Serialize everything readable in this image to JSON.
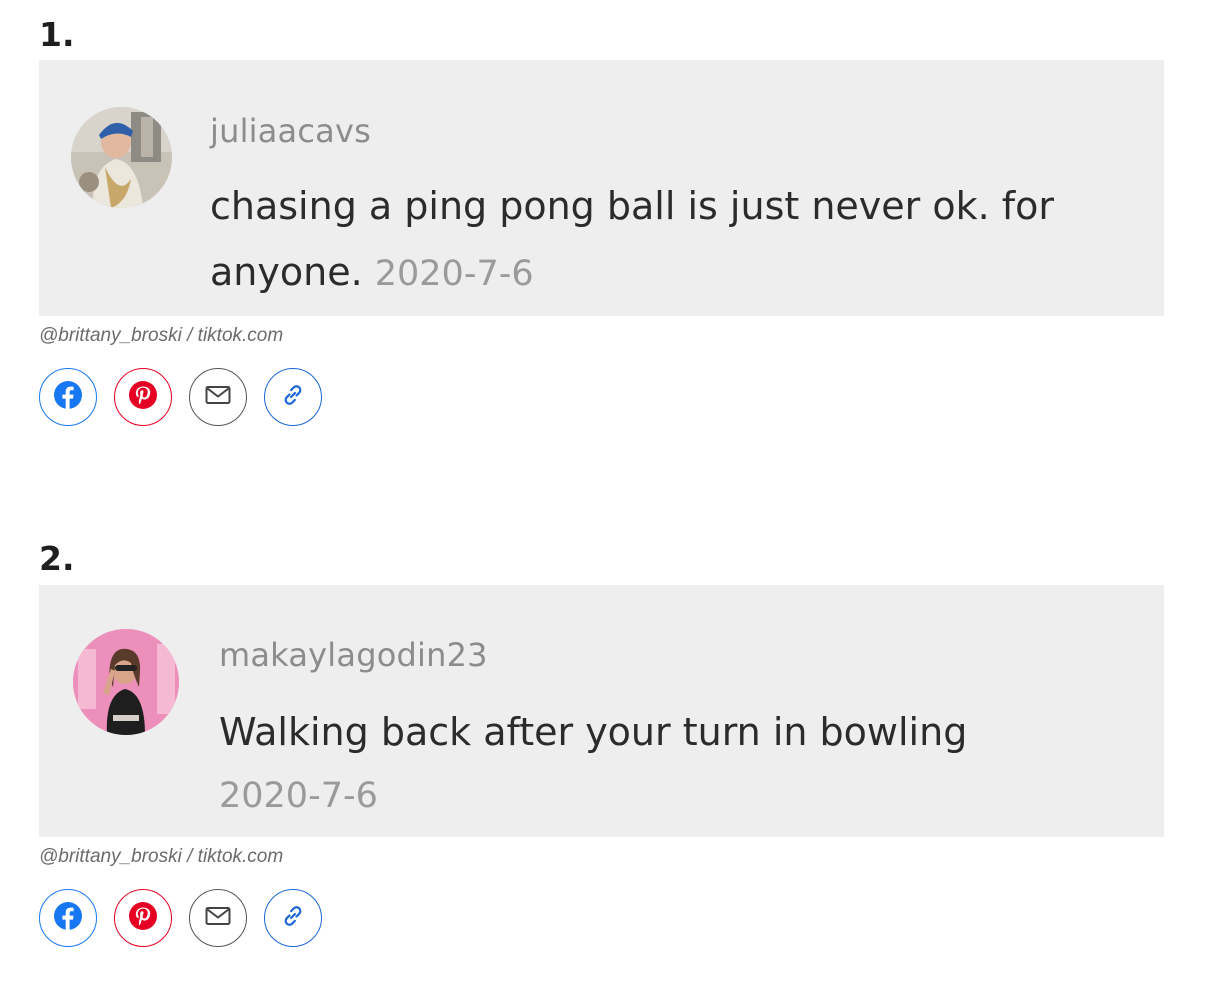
{
  "items": [
    {
      "number": "1.",
      "username": "juliaacavs",
      "comment": "chasing a ping pong ball is just never ok. for anyone.",
      "date": "2020-7-6",
      "credit": "@brittany_broski / tiktok.com"
    },
    {
      "number": "2.",
      "username": "makaylagodin23",
      "comment": "Walking back after your turn in bowling",
      "date": "2020-7-6",
      "credit": "@brittany_broski / tiktok.com"
    }
  ],
  "share_buttons": [
    {
      "icon": "facebook-icon",
      "color": "#1877f2"
    },
    {
      "icon": "pinterest-icon",
      "color": "#e60023"
    },
    {
      "icon": "email-icon",
      "color": "#555555"
    },
    {
      "icon": "link-icon",
      "color": "#1a66d6"
    }
  ],
  "colors": {
    "card_background": "#eeeeee",
    "username": "#8c8c8c",
    "comment_text": "#2b2b2b",
    "date": "#9a9a9a"
  }
}
